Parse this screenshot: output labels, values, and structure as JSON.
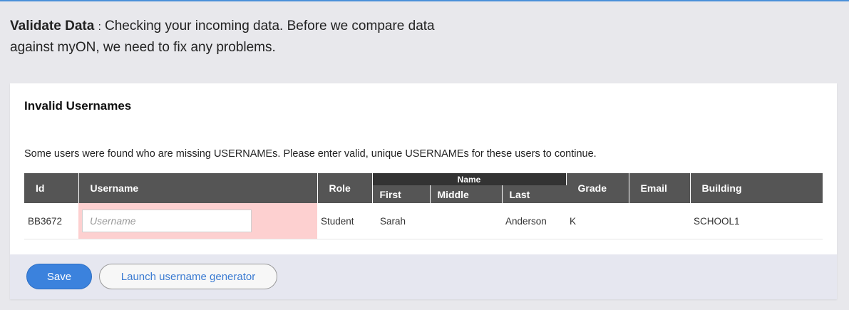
{
  "header": {
    "title": "Validate Data",
    "separator": ":",
    "message": "Checking your incoming data. Before we compare data against myON, we need to fix any problems."
  },
  "card": {
    "title": "Invalid Usernames",
    "description": "Some users were found who are missing USERNAMEs. Please enter valid, unique USERNAMEs for these users to continue."
  },
  "table": {
    "columns": {
      "id": "Id",
      "username": "Username",
      "role": "Role",
      "name_group": "Name",
      "first": "First",
      "middle": "Middle",
      "last": "Last",
      "grade": "Grade",
      "email": "Email",
      "building": "Building"
    },
    "rows": [
      {
        "id": "BB3672",
        "username_value": "",
        "username_placeholder": "Username",
        "role": "Student",
        "first": "Sarah",
        "middle": "",
        "last": "Anderson",
        "grade": "K",
        "email": "",
        "building": "SCHOOL1"
      }
    ]
  },
  "footer": {
    "save_label": "Save",
    "generator_label": "Launch username generator"
  },
  "colors": {
    "accent": "#3b82dd",
    "error_cell": "#fdd0d0",
    "header_bg": "#555555"
  }
}
